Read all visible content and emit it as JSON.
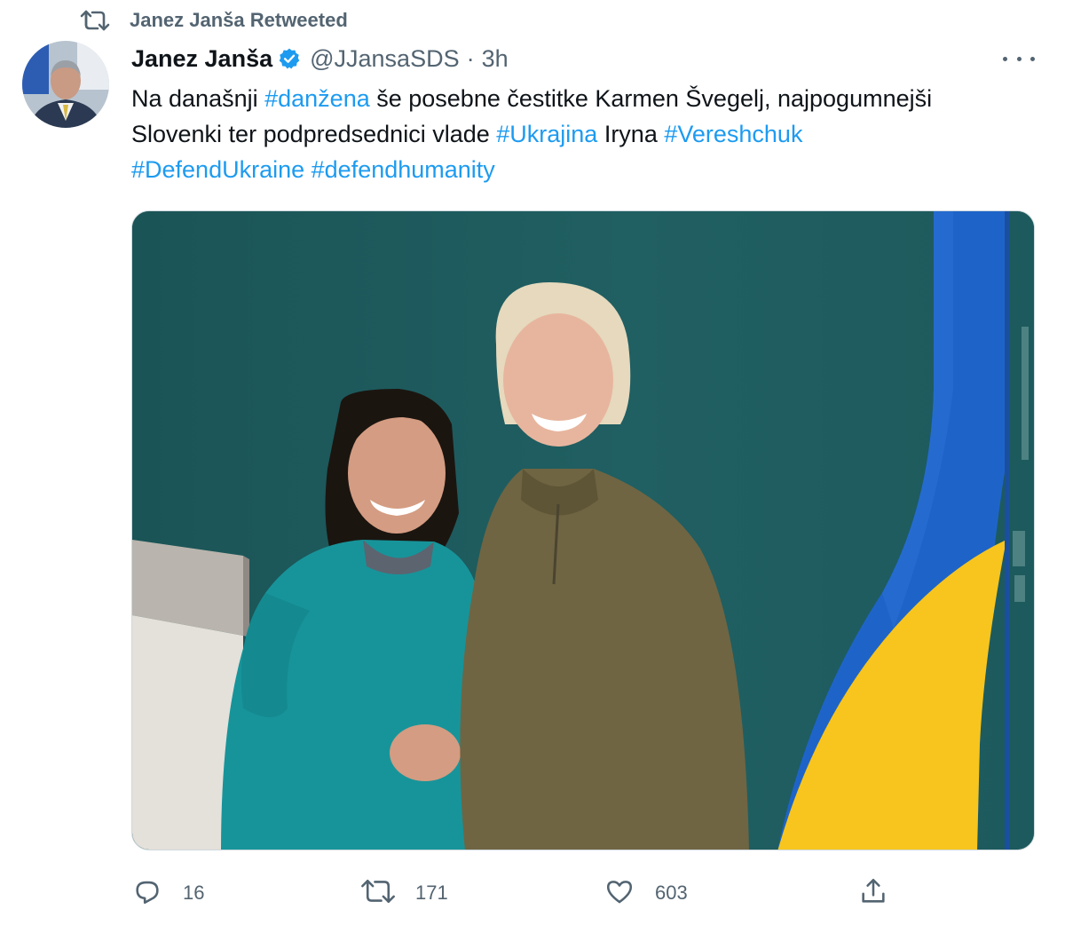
{
  "retweet": {
    "label": "Janez Janša Retweeted"
  },
  "tweet": {
    "author_name": "Janez Janša",
    "handle": "@JJansaSDS",
    "separator": "·",
    "time": "3h",
    "text_lines": [
      [
        {
          "t": "Na današnji ",
          "tag": false
        },
        {
          "t": "#danžena",
          "tag": true
        },
        {
          "t": " še posebne čestitke Karmen Švegelj, najpogumnejši",
          "tag": false
        }
      ],
      [
        {
          "t": "Slovenki ter podpredsednici vlade ",
          "tag": false
        },
        {
          "t": "#Ukrajina",
          "tag": true
        },
        {
          "t": " Iryna ",
          "tag": false
        },
        {
          "t": "#Vereshchuk",
          "tag": true
        }
      ],
      [
        {
          "t": "#DefendUkraine",
          "tag": true
        },
        {
          "t": " ",
          "tag": false
        },
        {
          "t": "#defendhumanity",
          "tag": true
        }
      ]
    ]
  },
  "actions": {
    "replies": "16",
    "retweets": "171",
    "likes": "603"
  },
  "icons": {
    "retweet": "retweet-icon",
    "verified": "verified-badge-icon",
    "more": "more-icon",
    "reply": "reply-icon",
    "like": "heart-icon",
    "share": "share-icon"
  },
  "colors": {
    "hashtag": "#1d9bf0",
    "secondary_text": "#536471",
    "verified": "#1d9bf0",
    "flag_blue": "#1e64c8",
    "flag_yellow": "#f7c51e"
  }
}
